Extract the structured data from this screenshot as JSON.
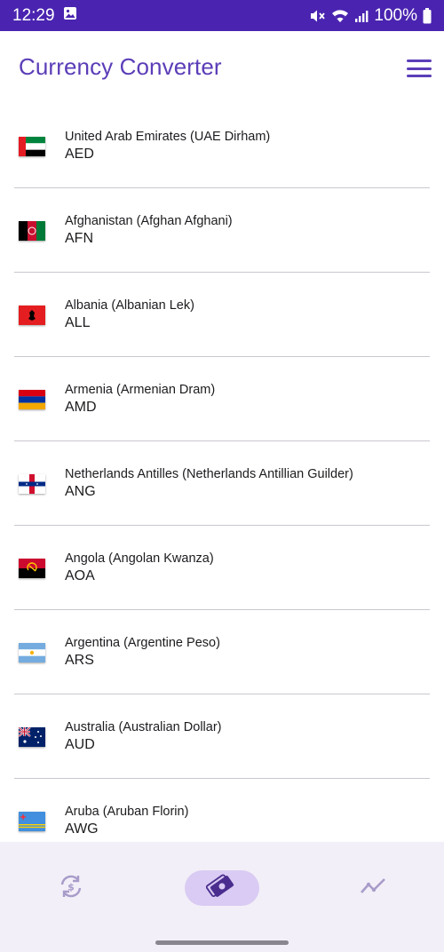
{
  "status_bar": {
    "time": "12:29",
    "battery": "100%",
    "icons": [
      "image-icon",
      "mute-icon",
      "wifi-icon",
      "signal-icon",
      "battery-icon"
    ]
  },
  "app_bar": {
    "title": "Currency Converter",
    "menu_icon": "hamburger-menu-icon"
  },
  "currencies": [
    {
      "name": "United Arab Emirates (UAE Dirham)",
      "code": "AED",
      "flag": "uae-flag-icon"
    },
    {
      "name": "Afghanistan (Afghan Afghani)",
      "code": "AFN",
      "flag": "afghanistan-flag-icon"
    },
    {
      "name": "Albania (Albanian Lek)",
      "code": "ALL",
      "flag": "albania-flag-icon"
    },
    {
      "name": "Armenia (Armenian Dram)",
      "code": "AMD",
      "flag": "armenia-flag-icon"
    },
    {
      "name": "Netherlands Antilles (Netherlands Antillian Guilder)",
      "code": "ANG",
      "flag": "netherlands-antilles-flag-icon"
    },
    {
      "name": "Angola (Angolan Kwanza)",
      "code": "AOA",
      "flag": "angola-flag-icon"
    },
    {
      "name": "Argentina (Argentine Peso)",
      "code": "ARS",
      "flag": "argentina-flag-icon"
    },
    {
      "name": "Australia (Australian Dollar)",
      "code": "AUD",
      "flag": "australia-flag-icon"
    },
    {
      "name": "Aruba (Aruban Florin)",
      "code": "AWG",
      "flag": "aruba-flag-icon"
    }
  ],
  "bottom_nav": {
    "items": [
      {
        "icon": "currency-exchange-icon",
        "active": false
      },
      {
        "icon": "money-icon",
        "active": true
      },
      {
        "icon": "trending-chart-icon",
        "active": false
      }
    ]
  },
  "colors": {
    "status_bar": "#4a24b0",
    "accent": "#5b3db8",
    "nav_background": "#f3eff8",
    "nav_active_pill": "#d9cbf3"
  }
}
